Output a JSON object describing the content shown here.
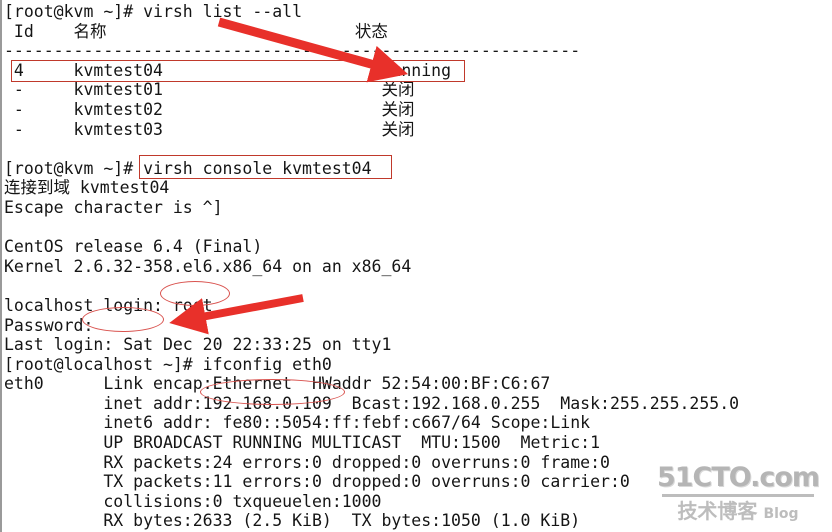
{
  "terminal": {
    "lines": [
      "[root@kvm ~]# virsh list --all",
      " Id    名称                         状态",
      "----------------------------------------------------------",
      " 4     kvmtest04                      running",
      " -     kvmtest01                      关闭",
      " -     kvmtest02                      关闭",
      " -     kvmtest03                      关闭",
      "",
      "[root@kvm ~]# virsh console kvmtest04",
      "连接到域 kvmtest04",
      "Escape character is ^]",
      "",
      "CentOS release 6.4 (Final)",
      "Kernel 2.6.32-358.el6.x86_64 on an x86_64",
      "",
      "localhost login: root",
      "Password:",
      "Last login: Sat Dec 20 22:33:25 on tty1",
      "[root@localhost ~]# ifconfig eth0",
      "eth0      Link encap:Ethernet  HWaddr 52:54:00:BF:C6:67",
      "          inet addr:192.168.0.109  Bcast:192.168.0.255  Mask:255.255.255.0",
      "          inet6 addr: fe80::5054:ff:febf:c667/64 Scope:Link",
      "          UP BROADCAST RUNNING MULTICAST  MTU:1500  Metric:1",
      "          RX packets:24 errors:0 dropped:0 overruns:0 frame:0",
      "          TX packets:11 errors:0 dropped:0 overruns:0 carrier:0",
      "          collisions:0 txqueuelen:1000",
      "          RX bytes:2633 (2.5 KiB)  TX bytes:1050 (1.0 KiB)"
    ],
    "commands": {
      "virsh_list": "virsh list --all",
      "virsh_console": "virsh console kvmtest04",
      "ifconfig": "ifconfig eth0"
    },
    "prompts": {
      "host_prompt": "[root@kvm ~]#",
      "guest_prompt": "[root@localhost ~]#",
      "login_prompt": "localhost login:",
      "password_prompt": "Password:"
    },
    "vm_table": {
      "headers": [
        "Id",
        "名称",
        "状态"
      ],
      "rows": [
        {
          "id": "4",
          "name": "kvmtest04",
          "state": "running"
        },
        {
          "id": "-",
          "name": "kvmtest01",
          "state": "关闭"
        },
        {
          "id": "-",
          "name": "kvmtest02",
          "state": "关闭"
        },
        {
          "id": "-",
          "name": "kvmtest03",
          "state": "关闭"
        }
      ]
    },
    "guest_info": {
      "os_release": "CentOS release 6.4 (Final)",
      "kernel": "Kernel 2.6.32-358.el6.x86_64 on an x86_64",
      "connect_msg": "连接到域 kvmtest04",
      "escape_msg": "Escape character is ^]",
      "last_login": "Last login: Sat Dec 20 22:33:25 on tty1",
      "login_user": "root"
    },
    "ifconfig": {
      "iface": "eth0",
      "hwaddr": "52:54:00:BF:C6:67",
      "inet_addr": "192.168.0.109",
      "bcast": "192.168.0.255",
      "mask": "255.255.255.0",
      "inet6_addr": "fe80::5054:ff:febf:c667/64",
      "scope": "Scope:Link",
      "flags": "UP BROADCAST RUNNING MULTICAST",
      "mtu": "1500",
      "metric": "1",
      "rx_packets": "24",
      "tx_packets": "11",
      "collisions": "0",
      "txqueuelen": "1000",
      "rx_bytes": "2633 (2.5 KiB)",
      "tx_bytes": "1050 (1.0 KiB)"
    }
  },
  "annotations": {
    "highlight_color": "#c0392b",
    "ellipse_color": "#d9534f",
    "arrow_color": "#e8302a",
    "boxes": [
      {
        "name": "running-row-box",
        "target": "kvmtest04 running row"
      },
      {
        "name": "virsh-console-command-box",
        "target": "virsh console kvmtest04"
      }
    ],
    "ellipses": [
      {
        "name": "login-user-ellipse",
        "target": "root"
      },
      {
        "name": "password-ellipse",
        "target": "Password:"
      },
      {
        "name": "ip-address-ellipse",
        "target": "192.168.0.109"
      }
    ],
    "arrows": [
      {
        "name": "arrow-to-running",
        "target": "running"
      },
      {
        "name": "arrow-to-password",
        "target": "Password:"
      }
    ]
  },
  "watermark": {
    "top": "51CTO.com",
    "bottom_cn": "技术博客",
    "bottom_en": "Blog"
  }
}
